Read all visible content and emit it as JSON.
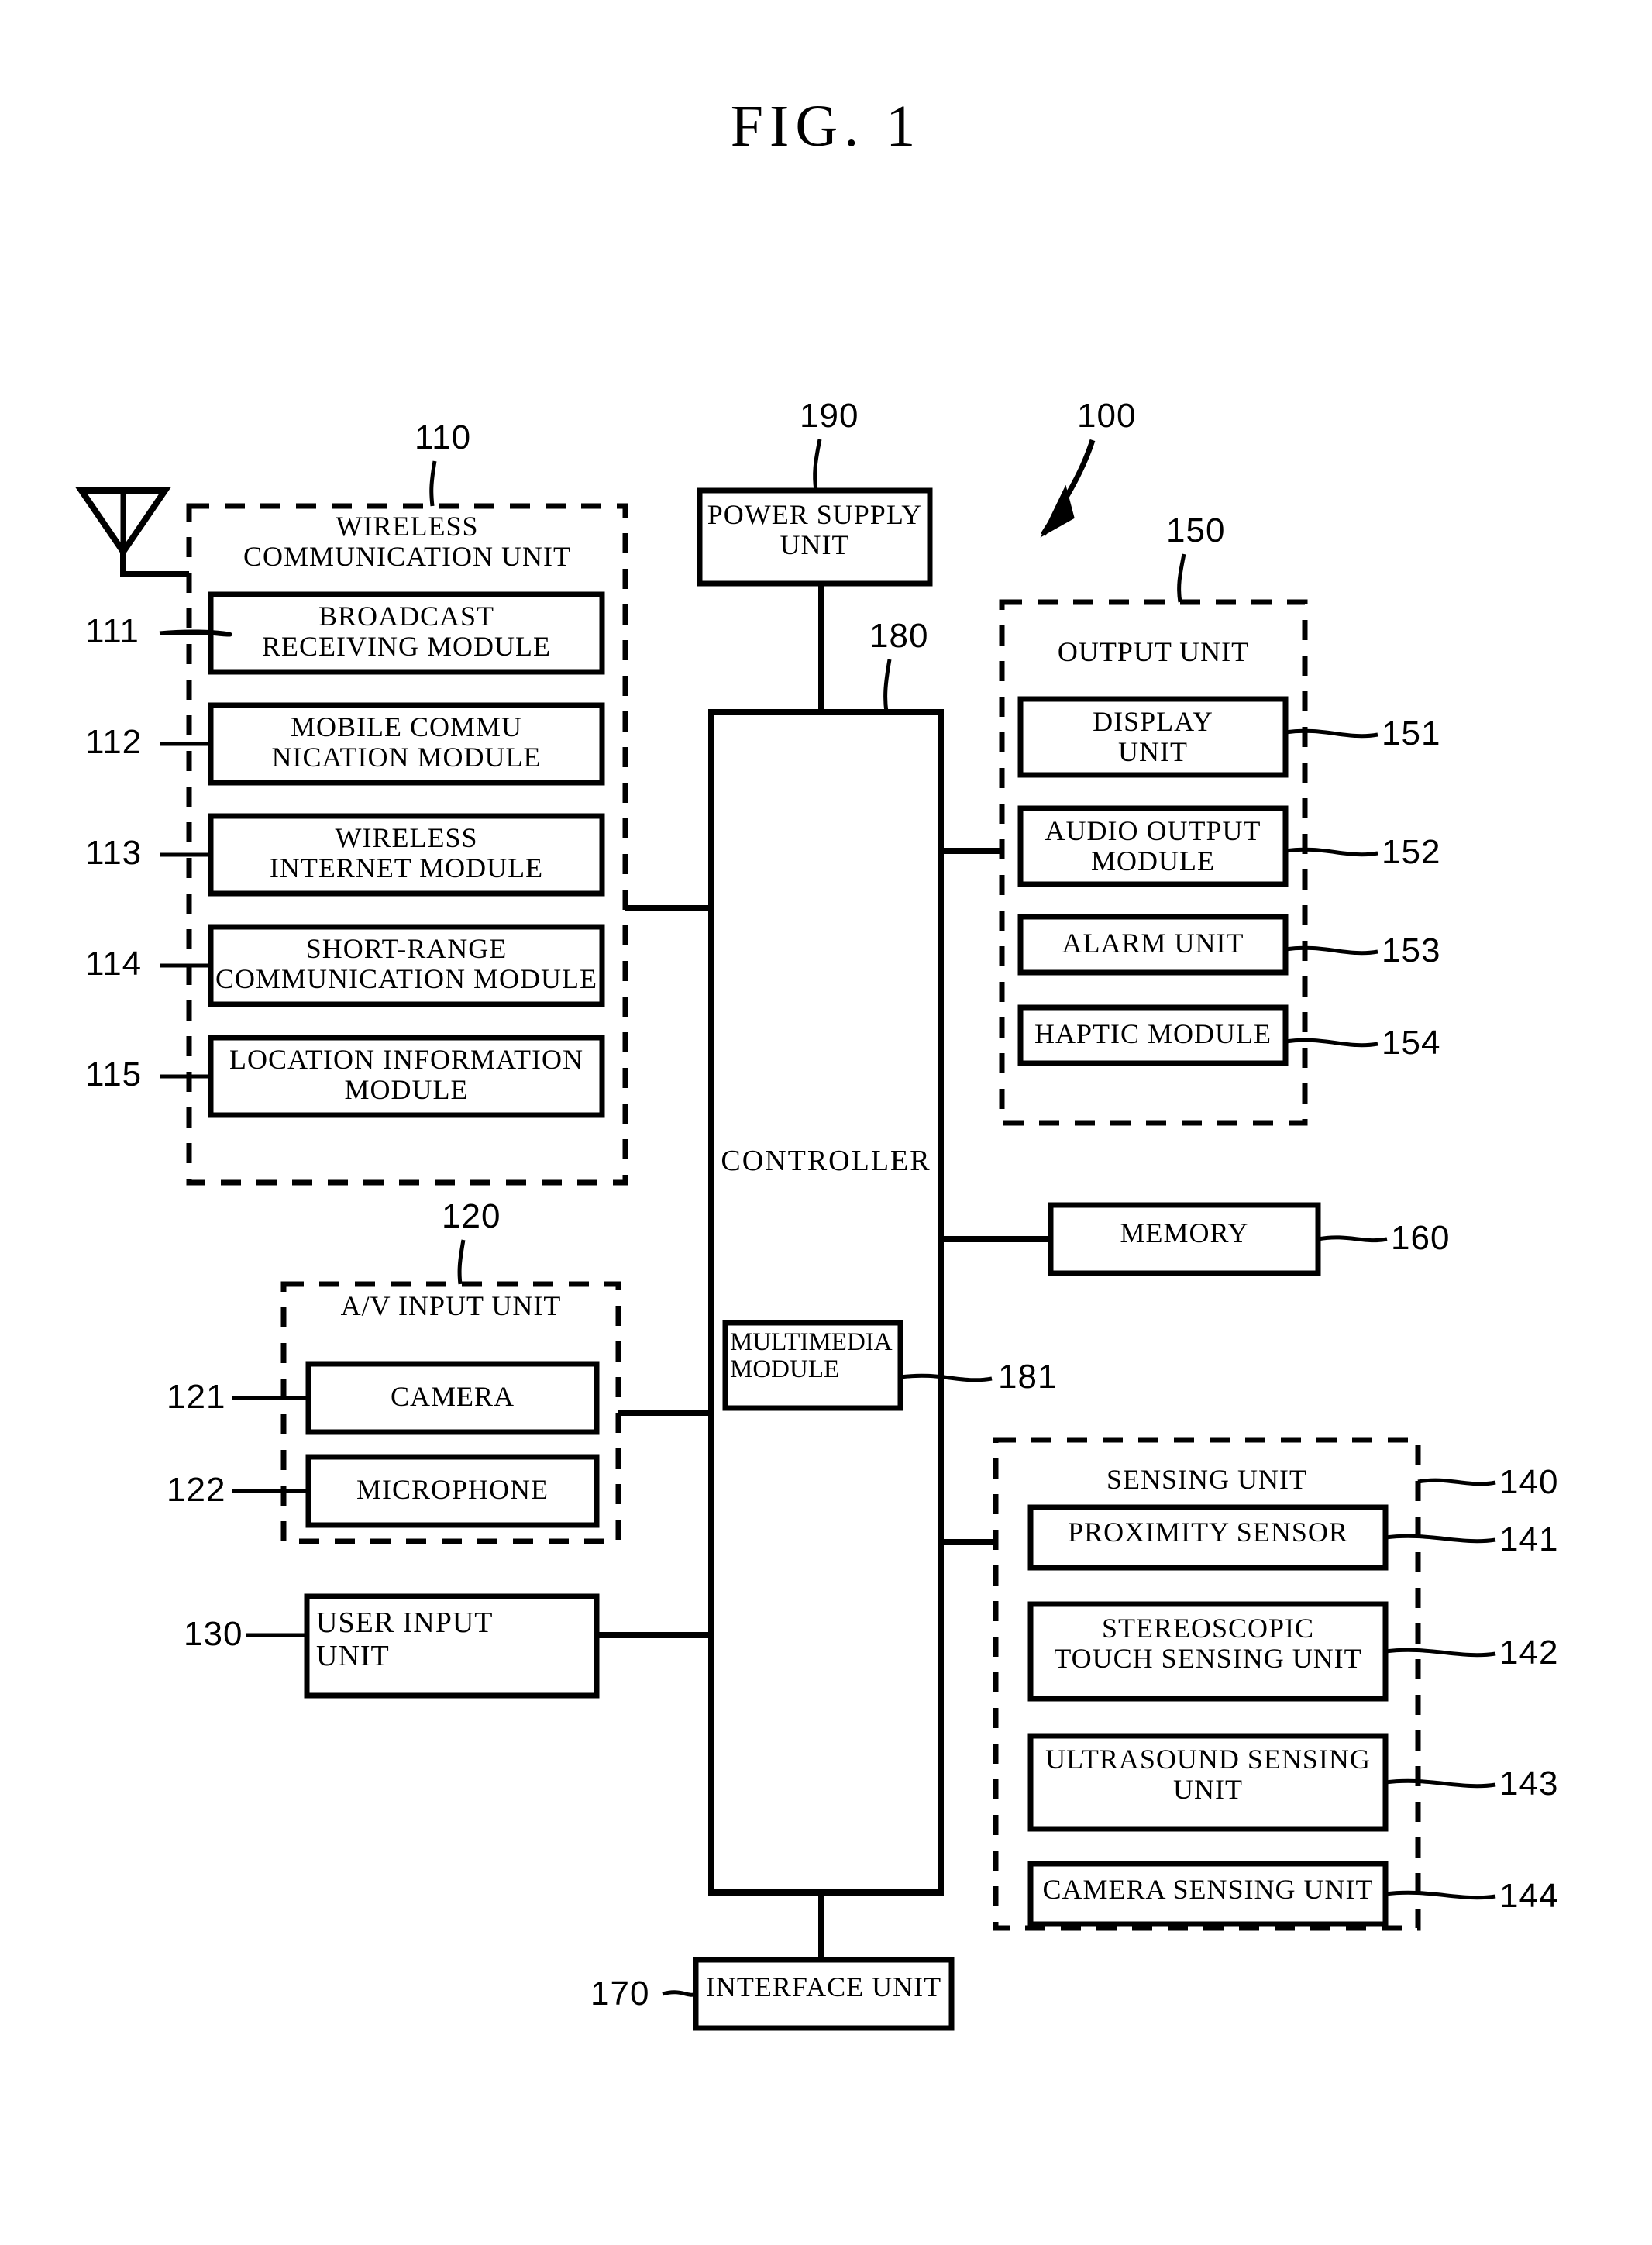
{
  "figure": {
    "title": "FIG. 1"
  },
  "antenna": {
    "name": "antenna-symbol"
  },
  "wireless_unit": {
    "ref": "110",
    "title": "WIRELESS\nCOMMUNICATION UNIT",
    "modules": [
      {
        "ref": "111",
        "label": "BROADCAST\nRECEIVING MODULE"
      },
      {
        "ref": "112",
        "label": "MOBILE COMMU\nNICATION MODULE"
      },
      {
        "ref": "113",
        "label": "WIRELESS\nINTERNET MODULE"
      },
      {
        "ref": "114",
        "label": "SHORT-RANGE\nCOMMUNICATION MODULE"
      },
      {
        "ref": "115",
        "label": "LOCATION INFORMATION\nMODULE"
      }
    ]
  },
  "av_input_unit": {
    "ref": "120",
    "title": "A/V INPUT UNIT",
    "modules": [
      {
        "ref": "121",
        "label": "CAMERA"
      },
      {
        "ref": "122",
        "label": "MICROPHONE"
      }
    ]
  },
  "user_input_unit": {
    "ref": "130",
    "label": "USER INPUT\nUNIT"
  },
  "power_supply_unit": {
    "ref": "190",
    "label": "POWER SUPPLY\nUNIT"
  },
  "controller": {
    "ref": "180",
    "label": "CONTROLLER",
    "multimedia_module": {
      "ref": "181",
      "label": "MULTIMEDIA\nMODULE"
    }
  },
  "device": {
    "ref": "100"
  },
  "output_unit": {
    "ref": "150",
    "title": "OUTPUT UNIT",
    "modules": [
      {
        "ref": "151",
        "label": "DISPLAY\nUNIT"
      },
      {
        "ref": "152",
        "label": "AUDIO OUTPUT\nMODULE"
      },
      {
        "ref": "153",
        "label": "ALARM UNIT"
      },
      {
        "ref": "154",
        "label": "HAPTIC MODULE"
      }
    ]
  },
  "memory": {
    "ref": "160",
    "label": "MEMORY"
  },
  "sensing_unit": {
    "ref": "140",
    "title": "SENSING UNIT",
    "modules": [
      {
        "ref": "141",
        "label": "PROXIMITY SENSOR"
      },
      {
        "ref": "142",
        "label": "STEREOSCOPIC\nTOUCH SENSING UNIT"
      },
      {
        "ref": "143",
        "label": "ULTRASOUND SENSING\nUNIT"
      },
      {
        "ref": "144",
        "label": "CAMERA SENSING UNIT"
      }
    ]
  },
  "interface_unit": {
    "ref": "170",
    "label": "INTERFACE UNIT"
  },
  "style": {
    "stroke": "#000000",
    "background": "#ffffff"
  }
}
